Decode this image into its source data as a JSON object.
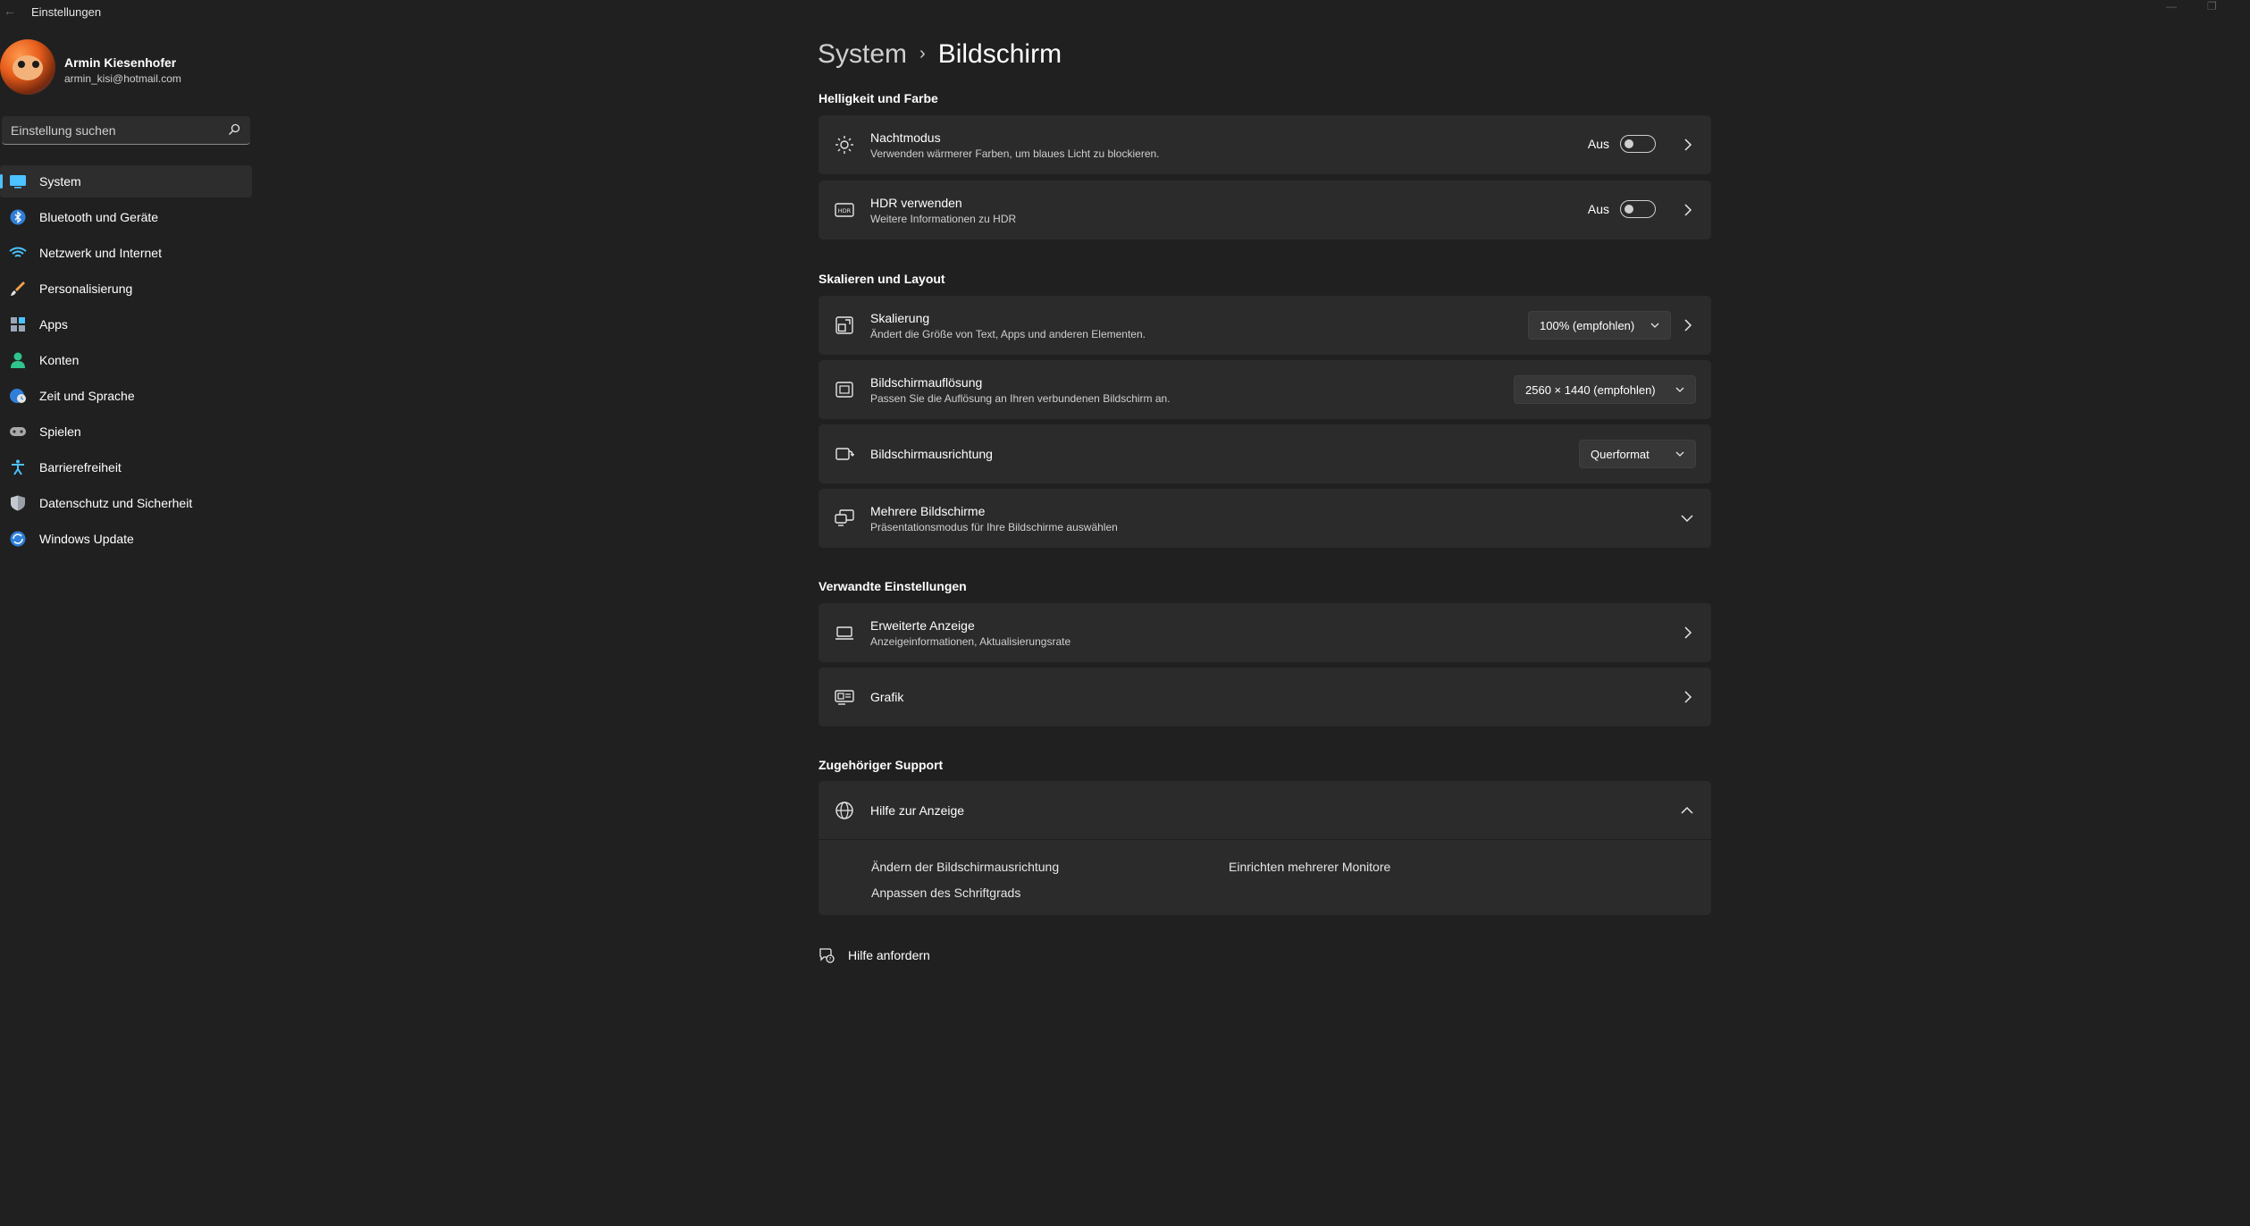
{
  "window": {
    "title": "Einstellungen",
    "back_glyph": "←",
    "minimize_glyph": "—",
    "maximize_glyph": "❐"
  },
  "profile": {
    "name": "Armin Kiesenhofer",
    "email": "armin_kisi@hotmail.com"
  },
  "search": {
    "placeholder": "Einstellung suchen",
    "icon": "search-icon"
  },
  "sidebar": {
    "items": [
      {
        "label": "System",
        "icon": "monitor-icon",
        "active": true
      },
      {
        "label": "Bluetooth und Geräte",
        "icon": "bluetooth-icon"
      },
      {
        "label": "Netzwerk und Internet",
        "icon": "wifi-icon"
      },
      {
        "label": "Personalisierung",
        "icon": "brush-icon"
      },
      {
        "label": "Apps",
        "icon": "apps-icon"
      },
      {
        "label": "Konten",
        "icon": "person-icon"
      },
      {
        "label": "Zeit und Sprache",
        "icon": "globe-clock-icon"
      },
      {
        "label": "Spielen",
        "icon": "gamepad-icon"
      },
      {
        "label": "Barrierefreiheit",
        "icon": "accessibility-icon"
      },
      {
        "label": "Datenschutz und Sicherheit",
        "icon": "shield-icon"
      },
      {
        "label": "Windows Update",
        "icon": "update-icon"
      }
    ]
  },
  "breadcrumb": {
    "parent": "System",
    "separator": "›",
    "current": "Bildschirm"
  },
  "sections": {
    "brightness": "Helligkeit und Farbe",
    "scale_layout": "Skalieren und Layout",
    "related": "Verwandte Einstellungen",
    "support": "Zugehöriger Support"
  },
  "settings": {
    "night": {
      "title": "Nachtmodus",
      "subtitle": "Verwenden wärmerer Farben, um blaues Licht zu blockieren.",
      "state": "Aus"
    },
    "hdr": {
      "title": "HDR verwenden",
      "subtitle": "Weitere Informationen zu HDR",
      "state": "Aus"
    },
    "scaling": {
      "title": "Skalierung",
      "subtitle": "Ändert die Größe von Text, Apps und anderen Elementen.",
      "value": "100% (empfohlen)"
    },
    "resolution": {
      "title": "Bildschirmauflösung",
      "subtitle": "Passen Sie die Auflösung an Ihren verbundenen Bildschirm an.",
      "value": "2560 × 1440 (empfohlen)"
    },
    "orientation": {
      "title": "Bildschirmausrichtung",
      "value": "Querformat"
    },
    "multiple": {
      "title": "Mehrere Bildschirme",
      "subtitle": "Präsentationsmodus für Ihre Bildschirme auswählen"
    },
    "advanced": {
      "title": "Erweiterte Anzeige",
      "subtitle": "Anzeigeinformationen, Aktualisierungsrate"
    },
    "graphics": {
      "title": "Grafik"
    }
  },
  "support": {
    "title": "Hilfe zur Anzeige",
    "links": [
      "Ändern der Bildschirmausrichtung",
      "Einrichten mehrerer Monitore",
      "Anpassen des Schriftgrads"
    ]
  },
  "help": {
    "label": "Hilfe anfordern"
  },
  "colors": {
    "background": "#202020",
    "card": "#2b2b2b",
    "accent": "#4cc2ff"
  }
}
